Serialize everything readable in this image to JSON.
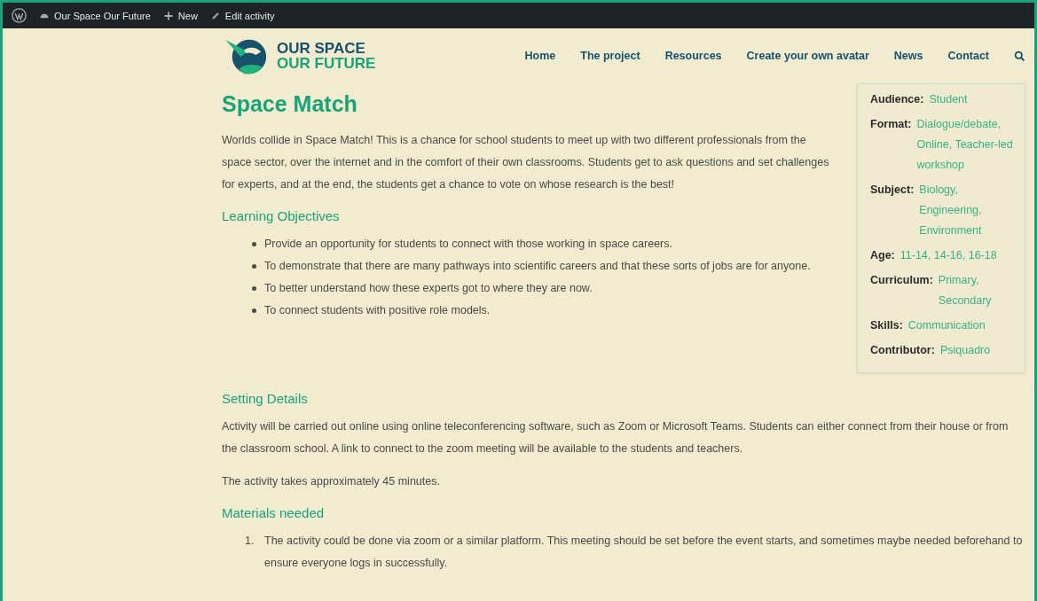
{
  "admin_bar": {
    "site": "Our Space Our Future",
    "new": "New",
    "edit": "Edit activity"
  },
  "logo": {
    "line1": "OUR SPACE",
    "line2": "OUR FUTURE"
  },
  "nav": [
    {
      "label": "Home"
    },
    {
      "label": "The project"
    },
    {
      "label": "Resources"
    },
    {
      "label": "Create your own avatar"
    },
    {
      "label": "News"
    },
    {
      "label": "Contact"
    }
  ],
  "title": "Space Match",
  "intro": "Worlds collide in Space Match! This is a chance for school students to meet up with two different professionals from the space sector, over the internet and in the comfort of their own classrooms. Students get to ask questions and set challenges for experts, and at the end, the students get a chance to vote on whose research is the best!",
  "sidebar": [
    {
      "label": "Audience:",
      "value": "Student"
    },
    {
      "label": "Format:",
      "value": "Dialogue/debate, Online, Teacher-led workshop"
    },
    {
      "label": "Subject:",
      "value": "Biology, Engineering, Environment"
    },
    {
      "label": "Age:",
      "value": "11-14, 14-16, 16-18"
    },
    {
      "label": "Curriculum:",
      "value": "Primary, Secondary"
    },
    {
      "label": "Skills:",
      "value": "Communication"
    },
    {
      "label": "Contributor:",
      "value": "Psiquadro"
    }
  ],
  "sections": [
    {
      "heading": "Learning Objectives",
      "kind": "bullets",
      "items": [
        "Provide an opportunity for students to connect with those working in space careers.",
        "To demonstrate that there are many pathways into scientific careers and that these sorts of jobs are for anyone.",
        "To better understand how these experts got to where they are now.",
        "To connect students with positive role models."
      ]
    },
    {
      "heading": "Setting Details",
      "kind": "paragraphs",
      "items": [
        "Activity will be carried out online using online teleconferencing software, such as Zoom or Microsoft Teams. Students can either connect from their house or from the classroom school. A link to connect to the zoom meeting will be available to the students and teachers.",
        "The activity takes approximately 45 minutes."
      ]
    },
    {
      "heading": "Materials needed",
      "kind": "numbered",
      "items": [
        {
          "number": "1.",
          "text": "The activity could be done via zoom or a similar platform. This meeting should be set before the event starts, and sometimes maybe needed beforehand to ensure everyone logs in successfully."
        }
      ]
    }
  ]
}
